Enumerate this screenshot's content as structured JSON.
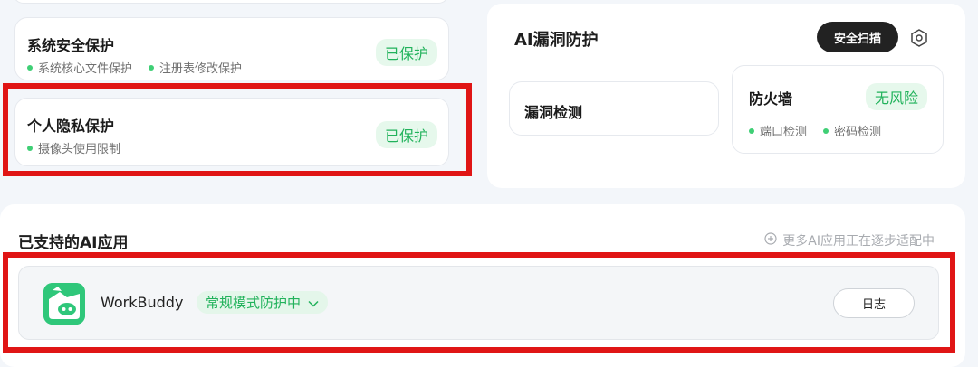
{
  "left_cards": [
    {
      "title": "系统安全保护",
      "status": "已保护",
      "features": [
        "系统核心文件保护",
        "注册表修改保护"
      ]
    },
    {
      "title": "个人隐私保护",
      "status": "已保护",
      "features": [
        "摄像头使用限制"
      ]
    }
  ],
  "vuln": {
    "title": "AI漏洞防护",
    "scan_button": "安全扫描",
    "icon": "settings-hex-icon",
    "detect_card": {
      "title": "漏洞检测"
    },
    "firewall": {
      "title": "防火墙",
      "status": "无风险",
      "features": [
        "端口检测",
        "密码检测"
      ]
    }
  },
  "apps": {
    "title": "已支持的AI应用",
    "more_label": "更多AI应用正在逐步适配中",
    "items": [
      {
        "name": "WorkBuddy",
        "mode": "常规模式防护中",
        "log_button": "日志"
      }
    ]
  },
  "colors": {
    "accent_green": "#21b25b",
    "highlight_red": "#e01515",
    "dark_button": "#222222"
  }
}
